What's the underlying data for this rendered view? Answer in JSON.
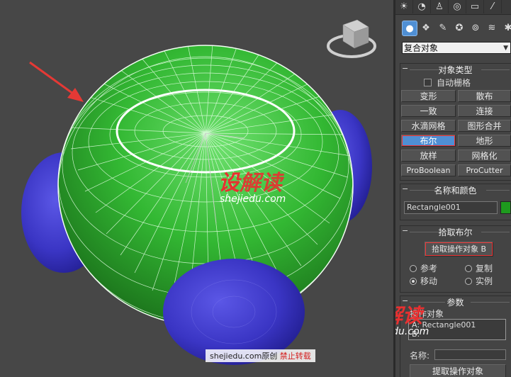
{
  "panel": {
    "dropdown_value": "复合对象",
    "object_type": {
      "title": "对象类型",
      "autogrid_label": "自动栅格",
      "buttons": [
        "变形",
        "散布",
        "一致",
        "连接",
        "水滴网格",
        "图形合并",
        "布尔",
        "地形",
        "放样",
        "网格化",
        "ProBoolean",
        "ProCutter"
      ]
    },
    "name_color": {
      "title": "名称和颜色",
      "name_value": "Rectangle001",
      "swatch_color": "#1e9a1e"
    },
    "pick_boolean": {
      "title": "拾取布尔",
      "pick_button": "拾取操作对象 B",
      "options": [
        "参考",
        "复制",
        "移动",
        "实例"
      ]
    },
    "parameters": {
      "title": "参数",
      "operands_label": "操作对象",
      "operand_a": "A: Rectangle001",
      "operand_b": "B:",
      "name_label": "名称:",
      "pick_operand_button": "提取操作对象"
    }
  },
  "watermark": {
    "brand_red": "设",
    "brand_rest": "解读",
    "domain": "shejiedu.com",
    "footer_domain": "shejiedu.com",
    "footer_original": "原创",
    "footer_forbid": "禁止转载"
  },
  "colors": {
    "accent_blue": "#4f8fd4",
    "sphere_green": "#2fb12f",
    "sphere_blue": "#3a36c8",
    "arrow_red": "#e53935"
  }
}
